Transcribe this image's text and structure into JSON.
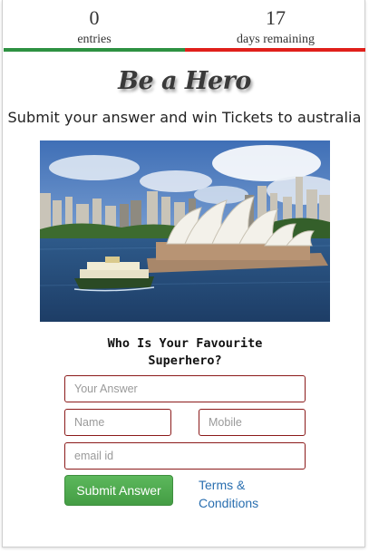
{
  "stats": {
    "entries": {
      "value": "0",
      "label": "entries"
    },
    "days": {
      "value": "17",
      "label": "days remaining"
    }
  },
  "colors": {
    "progress_left": "#2e9142",
    "progress_right": "#e0201b",
    "accent_link": "#2a6fb0",
    "submit": "#5cb85c",
    "field_border": "#8b1a1a"
  },
  "contest": {
    "title": "Be a Hero",
    "subtitle": "Submit your answer and win Tickets to australia",
    "image_icon": "sydney-opera-house-photo",
    "question": "Who Is Your Favourite Superhero?"
  },
  "form": {
    "answer_placeholder": "Your Answer",
    "name_placeholder": "Name",
    "mobile_placeholder": "Mobile",
    "email_placeholder": "email id",
    "submit_label": "Submit Answer",
    "terms_label": "Terms & Conditions"
  }
}
